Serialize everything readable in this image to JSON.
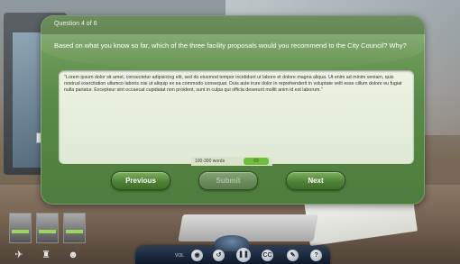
{
  "dialog": {
    "question_counter": "Question 4 of 6",
    "prompt": "Based on what you know so far, which of the three facility proposals would you recommend to the City Council? Why?",
    "answer_text": "\"Lorem ipsum dolor sit amet, consectetur adipisicing elit, sed do eiusmod tempor incididunt ut labore et dolore magna aliqua. Ut enim ad minim veniam, quis nostrud exercitation ullamco laboris nisi ut aliquip ex ea commodo consequat. Duis aute irure dolor in reprehenderit in voluptate velit esse cillum dolore eu fugiat nulla pariatur. Excepteur sint occaecat cupidatat non proident, sunt in culpa qui officia deserunt mollit anim id est laborum.\"",
    "word_count_label": "100-300 words",
    "word_count_value": "69",
    "buttons": {
      "previous": "Previous",
      "submit": "Submit",
      "next": "Next"
    }
  },
  "toolbar": {
    "volume_label": "VOL",
    "icons": [
      "speaker-icon",
      "rewind-icon",
      "pause-icon",
      "closed-captions-icon",
      "pencil-icon",
      "help-icon"
    ],
    "cc_label": "CC",
    "help_label": "?"
  },
  "colors": {
    "dialog_green": "#5a8a47",
    "accent_green": "#6fbf3c",
    "toolbar_navy": "#1a2a40"
  }
}
